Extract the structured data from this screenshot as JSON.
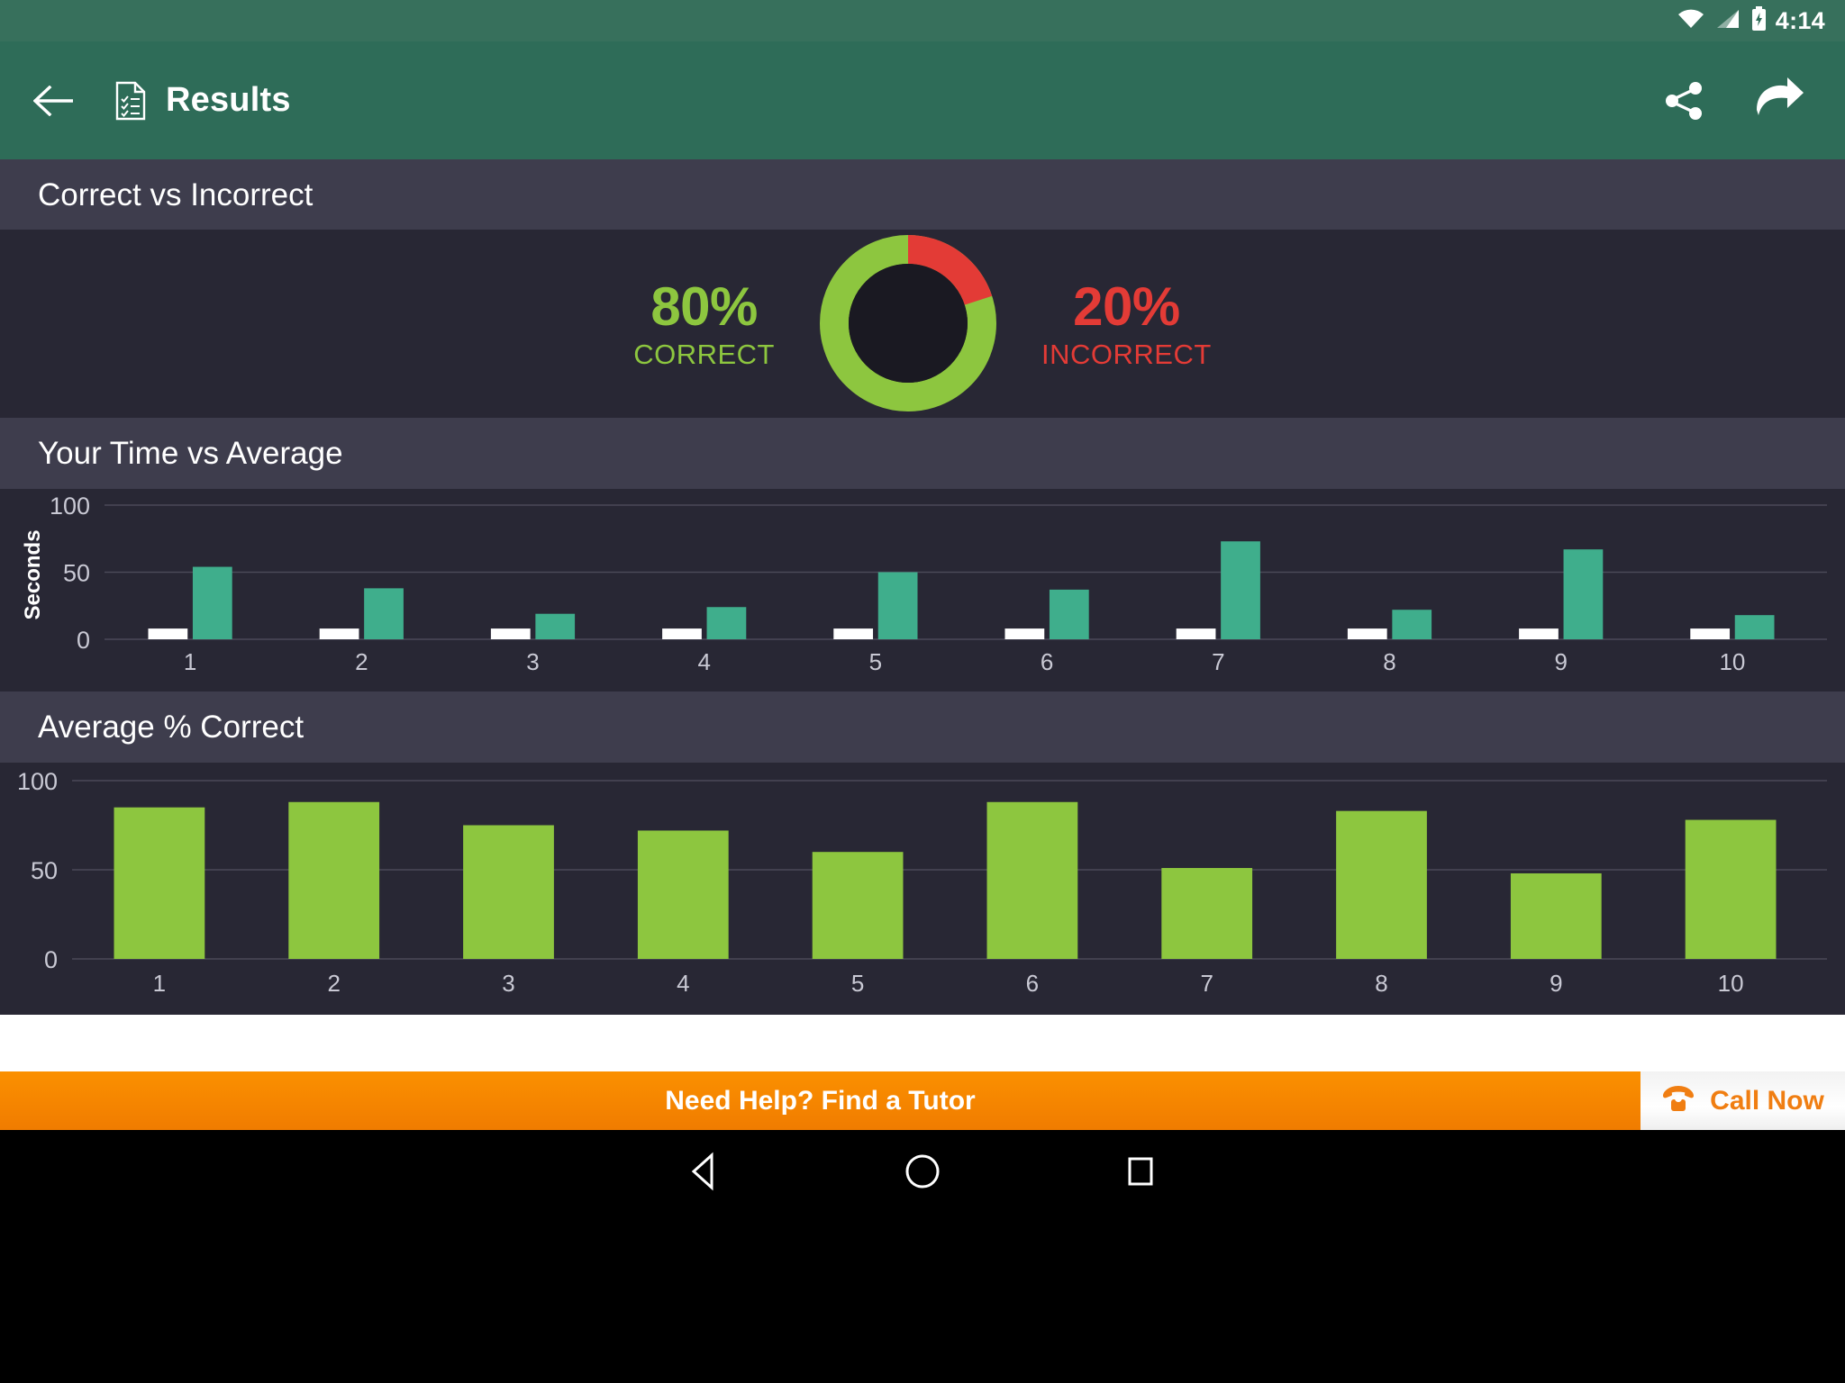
{
  "status_bar": {
    "time": "4:14",
    "icons": [
      "wifi-icon",
      "cellular-signal-icon",
      "battery-charging-icon"
    ]
  },
  "app_bar": {
    "back_icon": "back-arrow-icon",
    "doc_icon": "results-document-icon",
    "title": "Results",
    "actions": [
      {
        "icon": "share-icon",
        "name": "share-button"
      },
      {
        "icon": "send-forward-icon",
        "name": "forward-button"
      }
    ]
  },
  "sections": {
    "correct_vs_incorrect": {
      "title": "Correct vs Incorrect",
      "correct": {
        "percent": "80%",
        "label": "CORRECT",
        "color": "#8dc63f",
        "value": 80
      },
      "incorrect": {
        "percent": "20%",
        "label": "INCORRECT",
        "color": "#e33b36",
        "value": 20
      }
    },
    "time_vs_average": {
      "title": "Your Time vs Average"
    },
    "average_correct": {
      "title": "Average % Correct"
    }
  },
  "chart_data": [
    {
      "type": "pie",
      "title": "Correct vs Incorrect",
      "labels": [
        "CORRECT",
        "INCORRECT"
      ],
      "values": [
        80,
        20
      ],
      "colors": [
        "#8dc63f",
        "#e33b36"
      ],
      "donut": true,
      "legend": "sides"
    },
    {
      "type": "bar",
      "title": "Your Time vs Average",
      "categories": [
        "1",
        "2",
        "3",
        "4",
        "5",
        "6",
        "7",
        "8",
        "9",
        "10"
      ],
      "series": [
        {
          "name": "Average",
          "color": "#ffffff",
          "values": [
            8,
            8,
            8,
            8,
            8,
            8,
            8,
            8,
            8,
            8
          ]
        },
        {
          "name": "Your Time",
          "color": "#3fae8c",
          "values": [
            54,
            38,
            19,
            24,
            50,
            37,
            73,
            22,
            67,
            18
          ]
        }
      ],
      "xlabel": "",
      "ylabel": "Seconds",
      "ylim": [
        0,
        100
      ],
      "yticks": [
        0,
        50,
        100
      ],
      "ytick_labels": [
        "0",
        "50",
        "100"
      ],
      "grid": true,
      "legend": "none"
    },
    {
      "type": "bar",
      "title": "Average % Correct",
      "categories": [
        "1",
        "2",
        "3",
        "4",
        "5",
        "6",
        "7",
        "8",
        "9",
        "10"
      ],
      "values": [
        85,
        88,
        75,
        72,
        60,
        88,
        51,
        83,
        48,
        78
      ],
      "color": "#8dc63f",
      "xlabel": "",
      "ylabel": "",
      "ylim": [
        0,
        100
      ],
      "yticks": [
        0,
        50,
        100
      ],
      "ytick_labels": [
        "0",
        "50",
        "100"
      ],
      "grid": true,
      "legend": "none"
    }
  ],
  "tutor_banner": {
    "main_text": "Need Help? Find a Tutor",
    "call_text": "Call Now",
    "phone_icon": "telephone-icon",
    "bg_color": "#f58300",
    "accent_color": "#f07e12"
  },
  "nav_bar": {
    "back": "nav-back-triangle-icon",
    "home": "nav-home-circle-icon",
    "recents": "nav-recents-square-icon"
  },
  "theme": {
    "appbar_color": "#2e6c58",
    "section_header_color": "#3e3d4d",
    "panel_color": "#282734",
    "green": "#8dc63f",
    "red": "#e33b36",
    "teal": "#3fae8c"
  }
}
